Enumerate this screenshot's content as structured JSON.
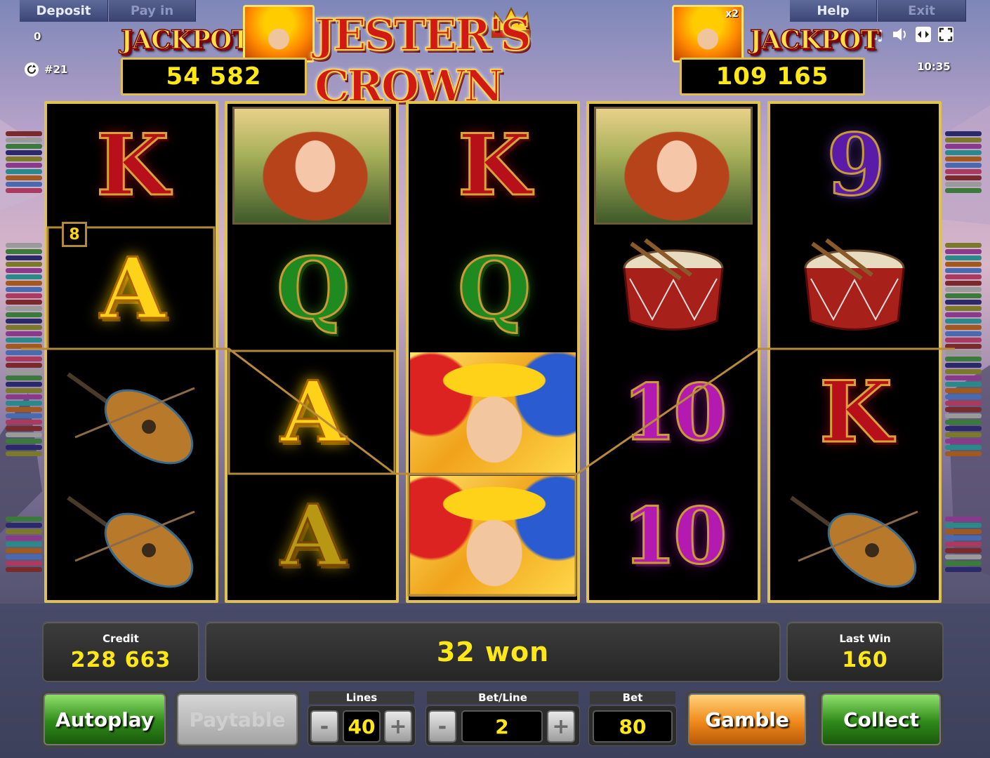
{
  "topbar": {
    "deposit_label": "Deposit",
    "payin_label": "Pay in",
    "help_label": "Help",
    "exit_label": "Exit",
    "deposit_value": "0",
    "game_number": "#21",
    "clock": "10:35"
  },
  "jackpots": [
    {
      "label": "JACKPOT",
      "value": "54 582"
    },
    {
      "label": "JACKPOT",
      "value": "109 165",
      "multiplier": "x2"
    }
  ],
  "logo": {
    "title": "JESTER'S CROWN"
  },
  "reels": [
    [
      "K",
      "A",
      "lute",
      "lute"
    ],
    [
      "lady",
      "Q",
      "A",
      "A"
    ],
    [
      "K",
      "Q",
      "jester",
      "jester"
    ],
    [
      "lady",
      "drum",
      "10",
      "10"
    ],
    [
      "9",
      "drum",
      "K",
      "lute"
    ]
  ],
  "win_line_number": "8",
  "status": {
    "credit_label": "Credit",
    "credit_value": "228 663",
    "message": "32 won",
    "last_win_label": "Last Win",
    "last_win_value": "160"
  },
  "controls": {
    "autoplay_label": "Autoplay",
    "paytable_label": "Paytable",
    "lines_label": "Lines",
    "lines_value": "40",
    "betline_label": "Bet/Line",
    "betline_value": "2",
    "bet_label": "Bet",
    "bet_value": "80",
    "gamble_label": "Gamble",
    "collect_label": "Collect",
    "minus": "-",
    "plus": "+"
  },
  "icons": [
    "refresh-icon",
    "music-icon",
    "speaker-icon",
    "fit-screen-icon",
    "fullscreen-icon",
    "crown-icon"
  ]
}
